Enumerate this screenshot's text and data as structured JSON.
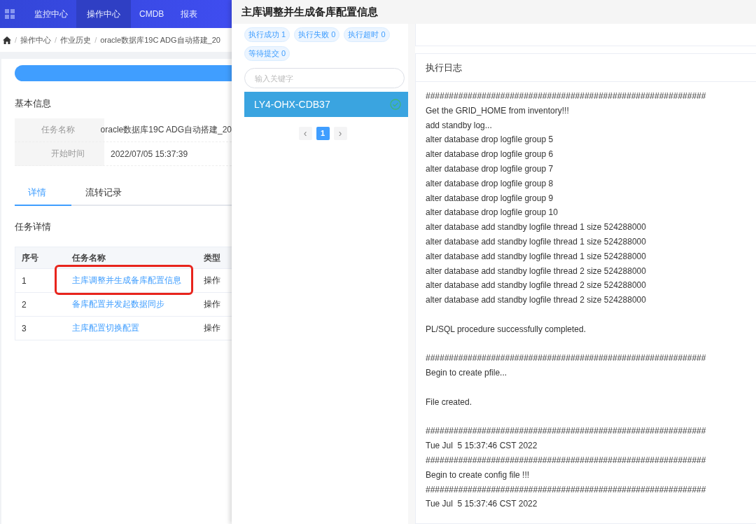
{
  "nav": {
    "items": [
      {
        "label": "监控中心",
        "selected": false
      },
      {
        "label": "操作中心",
        "selected": true
      },
      {
        "label": "CMDB",
        "selected": false
      },
      {
        "label": "报表",
        "selected": false
      }
    ]
  },
  "breadcrumb": {
    "separator": "/",
    "items": [
      "操作中心",
      "作业历史",
      "oracle数据库19C ADG自动搭建_20"
    ]
  },
  "progress": {
    "level": 1
  },
  "basic_info": {
    "title": "基本信息",
    "fields": [
      {
        "label": "任务名称",
        "value": "oracle数据库19C ADG自动搭建_20"
      },
      {
        "label": "开始时间",
        "value": "2022/07/05 15:37:39"
      }
    ]
  },
  "tabs": [
    {
      "label": "详情",
      "selected": true
    },
    {
      "label": "流转记录",
      "selected": false
    }
  ],
  "task_details": {
    "title": "任务详情",
    "columns": [
      "序号",
      "任务名称",
      "类型"
    ],
    "rows": [
      {
        "index": "1",
        "name": "主库调整并生成备库配置信息",
        "type": "操作",
        "highlighted": true
      },
      {
        "index": "2",
        "name": "备库配置并发起数据同步",
        "type": "操作",
        "highlighted": false
      },
      {
        "index": "3",
        "name": "主库配置切换配置",
        "type": "操作",
        "highlighted": false
      }
    ]
  },
  "drawer": {
    "title": "主库调整并生成备库配置信息",
    "status_tags": [
      "执行成功 1",
      "执行失败 0",
      "执行超时 0",
      "等待提交 0"
    ],
    "search": {
      "placeholder": "输入关键字"
    },
    "hosts": [
      {
        "name": "LY4-OHX-CDB37",
        "selected": true,
        "success": true
      }
    ],
    "pagination": {
      "prev": "‹",
      "next": "›",
      "pages": [
        {
          "label": "1",
          "selected": true
        }
      ]
    },
    "log": {
      "title": "执行日志",
      "blocks": [
        [
          "############################################################",
          "Get the GRID_HOME from inventory!!!",
          "add standby log...",
          "alter database drop logfile group 5",
          "alter database drop logfile group 6",
          "alter database drop logfile group 7",
          "alter database drop logfile group 8",
          "alter database drop logfile group 9",
          "alter database drop logfile group 10",
          "alter database add standby logfile thread 1 size 524288000",
          "alter database add standby logfile thread 1 size 524288000",
          "alter database add standby logfile thread 1 size 524288000",
          "alter database add standby logfile thread 2 size 524288000",
          "alter database add standby logfile thread 2 size 524288000",
          "alter database add standby logfile thread 2 size 524288000"
        ],
        [
          "PL/SQL procedure successfully completed."
        ],
        [
          "############################################################",
          "Begin to create pfile..."
        ],
        [
          "File created."
        ],
        [
          "############################################################",
          "Tue Jul  5 15:37:46 CST 2022",
          "############################################################",
          "Begin to create config file !!!",
          "############################################################",
          "Tue Jul  5 15:37:46 CST 2022"
        ]
      ]
    }
  }
}
